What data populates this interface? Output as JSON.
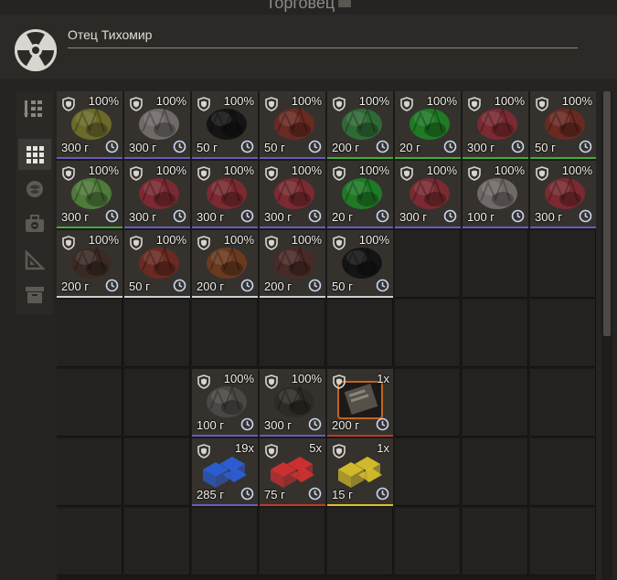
{
  "window": {
    "title": "Торговец"
  },
  "trader": {
    "name": "Отец Тихомир",
    "logo_icon": "radiation-icon"
  },
  "sidebar": {
    "tabs": [
      {
        "icon": "sort-icon",
        "active": false
      },
      {
        "icon": "grid-icon",
        "active": true
      },
      {
        "icon": "artifact-icon",
        "active": false
      },
      {
        "icon": "medkit-icon",
        "active": false
      },
      {
        "icon": "ruler-icon",
        "active": false
      },
      {
        "icon": "box-icon",
        "active": false
      }
    ]
  },
  "inventory": {
    "items": [
      {
        "name": "item-yellow-artifact",
        "qty": "100%",
        "price": "300 г",
        "color": "#6b6a2a",
        "underline": "#6a5bc0",
        "icon": "artifact-icon"
      },
      {
        "name": "item-gray-flower",
        "qty": "100%",
        "price": "300 г",
        "color": "#6f6a68",
        "underline": "#6a5bc0",
        "icon": "artifact-icon"
      },
      {
        "name": "item-black-crystal",
        "qty": "100%",
        "price": "50 г",
        "color": "#141414",
        "underline": "#6a5bc0",
        "icon": "artifact-icon"
      },
      {
        "name": "item-red-rose",
        "qty": "100%",
        "price": "50 г",
        "color": "#6a2a22",
        "underline": "#6a5bc0",
        "icon": "artifact-icon"
      },
      {
        "name": "item-green-bubbles",
        "qty": "100%",
        "price": "200 г",
        "color": "#2f6a35",
        "underline": "#3fae3f",
        "icon": "artifact-icon"
      },
      {
        "name": "item-green-crystal",
        "qty": "100%",
        "price": "20 г",
        "color": "#1f7a25",
        "underline": "#3fae3f",
        "icon": "artifact-icon"
      },
      {
        "name": "item-red-thorns",
        "qty": "100%",
        "price": "300 г",
        "color": "#7a2a30",
        "underline": "#3fae3f",
        "icon": "artifact-icon"
      },
      {
        "name": "item-red-rose-2",
        "qty": "100%",
        "price": "50 г",
        "color": "#6a2a22",
        "underline": "#3fae3f",
        "icon": "artifact-icon"
      },
      {
        "name": "item-green-plant",
        "qty": "100%",
        "price": "300 г",
        "color": "#4e7a3a",
        "underline": "#3fae3f",
        "icon": "artifact-icon"
      },
      {
        "name": "item-red-coral",
        "qty": "100%",
        "price": "300 г",
        "color": "#7a2a30",
        "underline": "#6a5bc0",
        "icon": "artifact-icon"
      },
      {
        "name": "item-red-coral-2",
        "qty": "100%",
        "price": "300 г",
        "color": "#7a2a30",
        "underline": "#6a5bc0",
        "icon": "artifact-icon"
      },
      {
        "name": "item-red-coral-3",
        "qty": "100%",
        "price": "300 г",
        "color": "#7a2a30",
        "underline": "#6a5bc0",
        "icon": "artifact-icon"
      },
      {
        "name": "item-green-crystal-2",
        "qty": "100%",
        "price": "20 г",
        "color": "#1f7a25",
        "underline": "#6a5bc0",
        "icon": "artifact-icon"
      },
      {
        "name": "item-red-coral-4",
        "qty": "100%",
        "price": "300 г",
        "color": "#7a2a30",
        "underline": "#6a5bc0",
        "icon": "artifact-icon"
      },
      {
        "name": "item-gray-flower-2",
        "qty": "100%",
        "price": "100 г",
        "color": "#6f6a68",
        "underline": "#6a5bc0",
        "icon": "artifact-icon"
      },
      {
        "name": "item-red-coral-5",
        "qty": "100%",
        "price": "300 г",
        "color": "#7a2a30",
        "underline": "#6a5bc0",
        "icon": "artifact-icon"
      },
      {
        "name": "item-dark-spikes",
        "qty": "100%",
        "price": "200 г",
        "color": "#3b2a24",
        "underline": "#cfcfcf",
        "icon": "artifact-icon"
      },
      {
        "name": "item-red-rose-3",
        "qty": "100%",
        "price": "50 г",
        "color": "#6a2a22",
        "underline": "#cfcfcf",
        "icon": "artifact-icon"
      },
      {
        "name": "item-orange-lava",
        "qty": "100%",
        "price": "200 г",
        "color": "#6a3a1f",
        "underline": "#cfcfcf",
        "icon": "artifact-icon"
      },
      {
        "name": "item-dark-red-rock",
        "qty": "100%",
        "price": "200 г",
        "color": "#4a2a26",
        "underline": "#cfcfcf",
        "icon": "artifact-icon"
      },
      {
        "name": "item-black-crystal-2",
        "qty": "100%",
        "price": "50 г",
        "color": "#141414",
        "underline": "#cfcfcf",
        "icon": "artifact-icon"
      },
      {
        "name": "item-gray-sphere",
        "qty": "100%",
        "price": "100 г",
        "color": "#4a4845",
        "underline": "#6a5bc0",
        "icon": "artifact-icon"
      },
      {
        "name": "item-dark-cluster",
        "qty": "100%",
        "price": "300 г",
        "color": "#2e2b26",
        "underline": "#6a5bc0",
        "icon": "artifact-icon"
      },
      {
        "name": "item-document-case",
        "qty": "1x",
        "price": "200 г",
        "color": "#3a3632",
        "underline": "#c0392b",
        "icon": "document-icon"
      },
      {
        "name": "item-blue-cubes",
        "qty": "19x",
        "price": "285 г",
        "color": "#2b5fd9",
        "underline": "#6a5bc0",
        "icon": "cubes-icon"
      },
      {
        "name": "item-red-cubes",
        "qty": "5x",
        "price": "75 г",
        "color": "#d43030",
        "underline": "#c0392b",
        "icon": "cubes-icon"
      },
      {
        "name": "item-yellow-cubes",
        "qty": "1x",
        "price": "15 г",
        "color": "#d9c12b",
        "underline": "#d9c12b",
        "icon": "cubes-icon"
      }
    ]
  }
}
